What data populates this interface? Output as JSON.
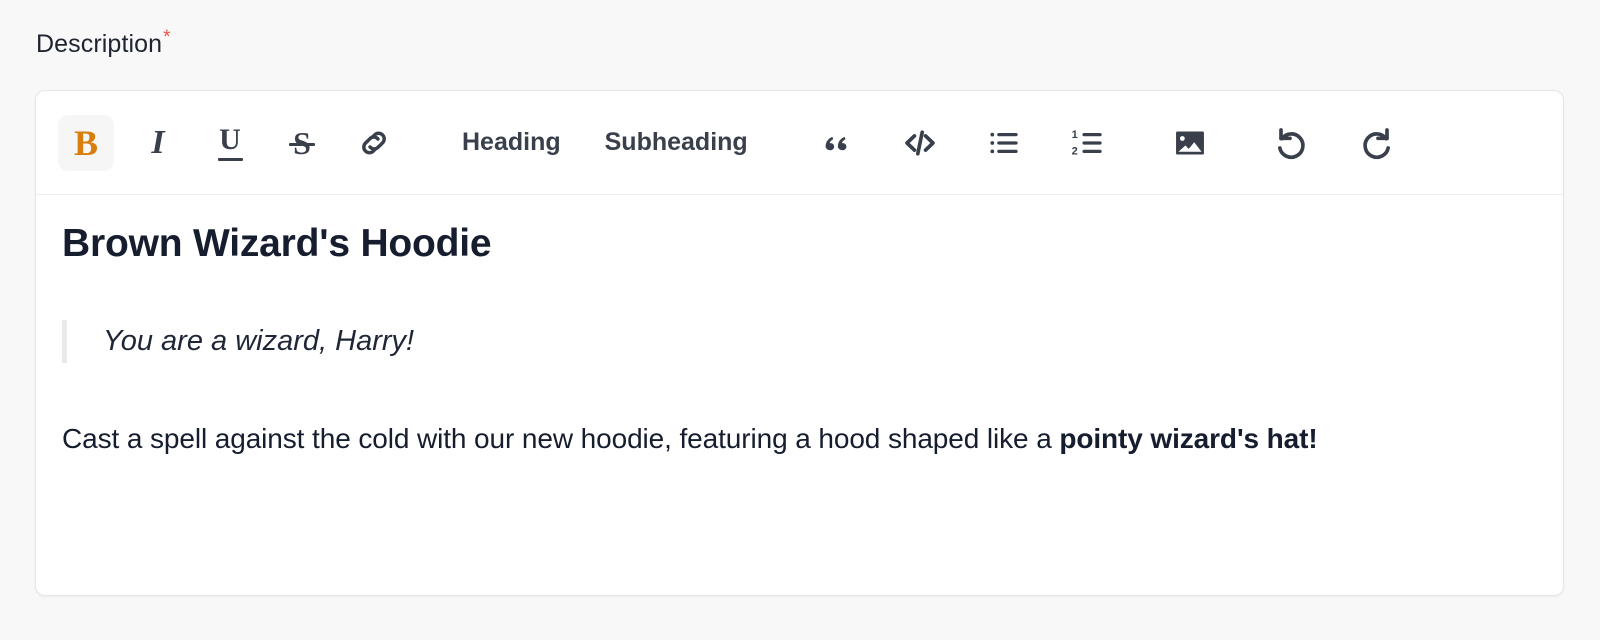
{
  "field": {
    "label": "Description",
    "required_marker": "*",
    "required_color": "#e8543f"
  },
  "toolbar": {
    "accent_active_color": "#d97d0d",
    "active_bg_color": "#f6f6f7",
    "icon_color": "#3a404b",
    "items": [
      {
        "name": "bold",
        "kind": "glyph",
        "label": "B",
        "active": true
      },
      {
        "name": "italic",
        "kind": "glyph",
        "label": "I",
        "active": false
      },
      {
        "name": "underline",
        "kind": "glyph",
        "label": "U",
        "active": false
      },
      {
        "name": "strikethrough",
        "kind": "glyph",
        "label": "S",
        "active": false
      },
      {
        "name": "link",
        "kind": "icon",
        "label": "link",
        "active": false
      },
      {
        "name": "heading",
        "kind": "text",
        "label": "Heading",
        "active": false
      },
      {
        "name": "subheading",
        "kind": "text",
        "label": "Subheading",
        "active": false
      },
      {
        "name": "blockquote",
        "kind": "icon",
        "label": "quote",
        "active": false
      },
      {
        "name": "code-block",
        "kind": "icon",
        "label": "</>",
        "active": false
      },
      {
        "name": "bullet-list",
        "kind": "icon",
        "label": "bullet-list",
        "active": false
      },
      {
        "name": "ordered-list",
        "kind": "icon",
        "label": "ordered-list",
        "active": false
      },
      {
        "name": "image",
        "kind": "icon",
        "label": "image",
        "active": false
      },
      {
        "name": "undo",
        "kind": "icon",
        "label": "undo",
        "active": false
      },
      {
        "name": "redo",
        "kind": "icon",
        "label": "redo",
        "active": false
      }
    ]
  },
  "document": {
    "heading": "Brown Wizard's Hoodie",
    "quote": "You are a wizard, Harry!",
    "paragraph_lead": "Cast a spell against the cold with our new hoodie, featuring a hood shaped like a ",
    "paragraph_bold": "pointy wizard's hat!"
  }
}
